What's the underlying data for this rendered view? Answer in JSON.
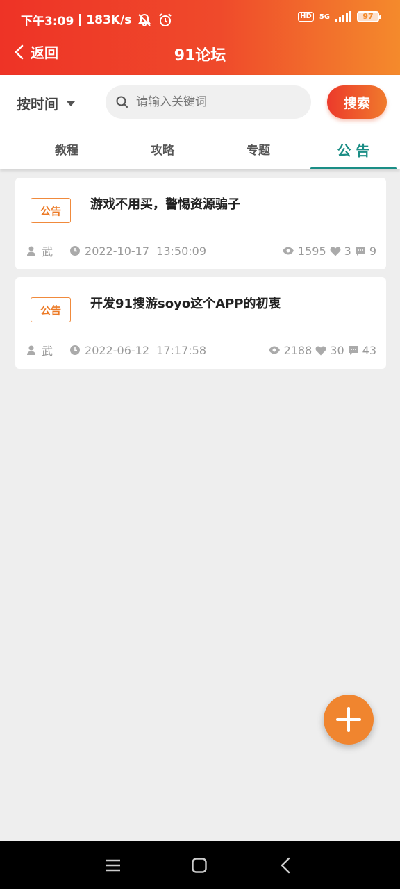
{
  "status_bar": {
    "time": "下午3:09",
    "speed": "183K/s",
    "hd": "HD",
    "network": "5G",
    "battery": "97"
  },
  "nav": {
    "back_label": "返回",
    "title": "91论坛"
  },
  "toolbar": {
    "sort_label": "按时间",
    "search_placeholder": "请输入关键词",
    "search_button": "搜索"
  },
  "tabs": [
    {
      "label": "教程",
      "active": false
    },
    {
      "label": "攻略",
      "active": false
    },
    {
      "label": "专题",
      "active": false
    },
    {
      "label": "公 告",
      "active": true
    }
  ],
  "posts": [
    {
      "tag": "公告",
      "title": "游戏不用买，警惕资源骗子",
      "author": "武",
      "datetime": "2022-10-17  13:50:09",
      "views": "1595",
      "likes": "3",
      "comments": "9"
    },
    {
      "tag": "公告",
      "title": "开发91搜游soyo这个APP的初衷",
      "author": "武",
      "datetime": "2022-06-12  17:17:58",
      "views": "2188",
      "likes": "30",
      "comments": "43"
    }
  ],
  "colors": {
    "header_start": "#ee3326",
    "header_end": "#f48a2c",
    "tab_active": "#1b8e86",
    "tag_orange": "#ec7a26",
    "fab": "#f0852f"
  }
}
